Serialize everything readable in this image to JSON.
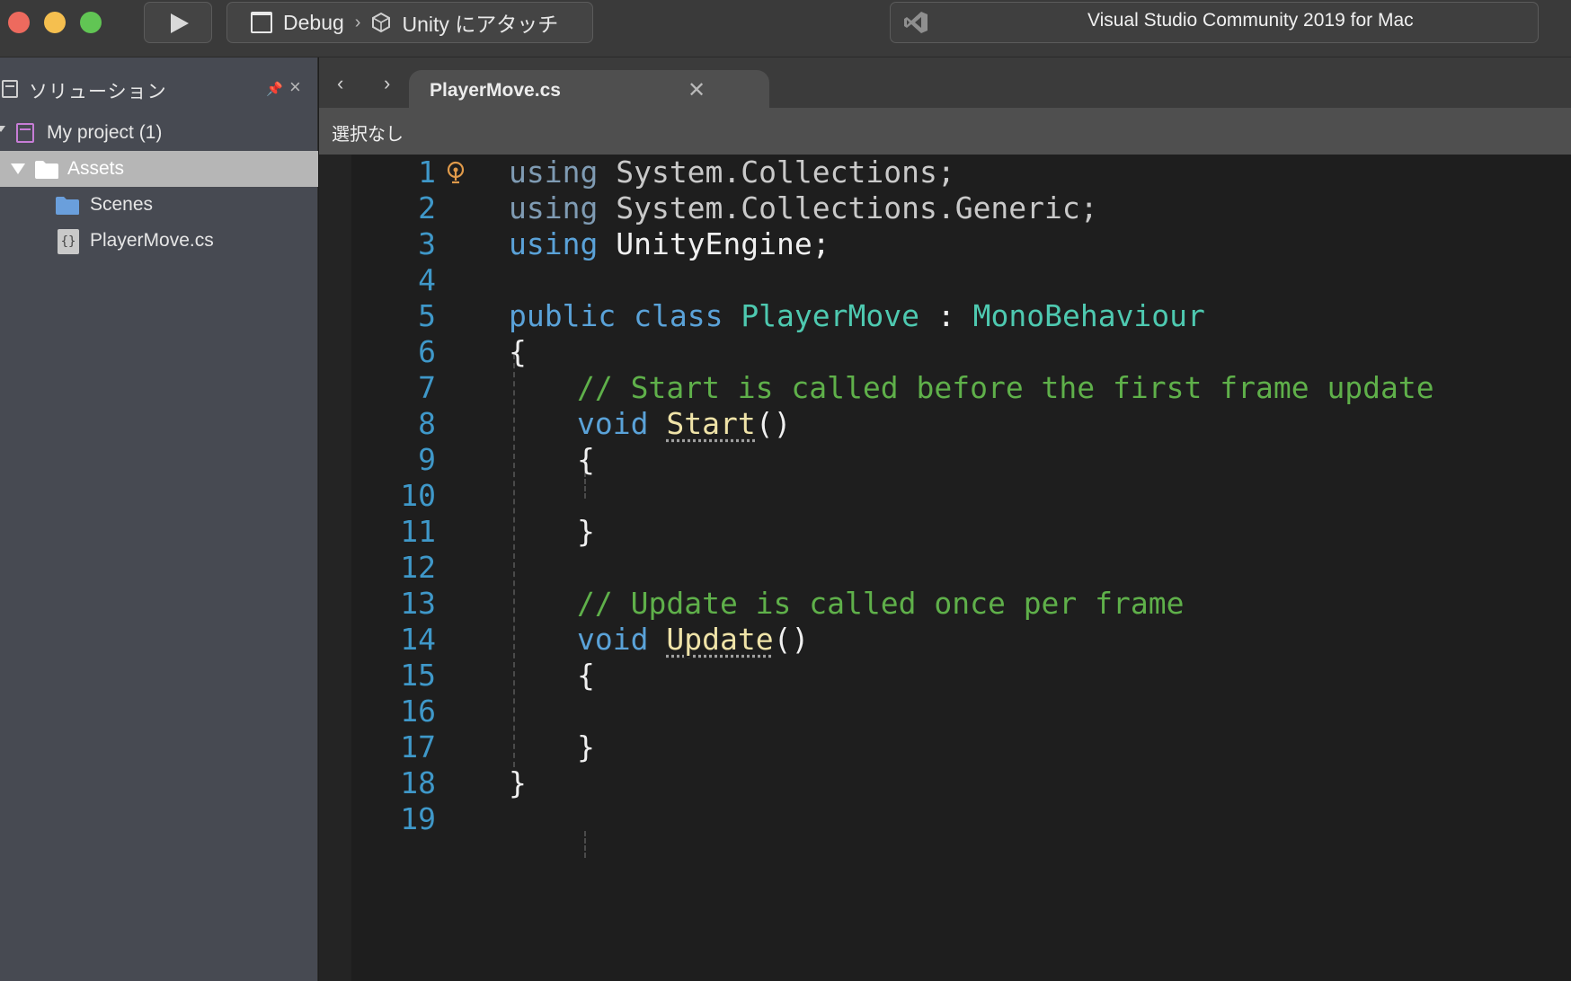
{
  "toolbar": {
    "run_icon": "play-icon",
    "configuration": "Debug",
    "separator": "›",
    "target": "Unity にアタッチ",
    "search_placeholder": "Visual Studio Community 2019 for Mac"
  },
  "sidebar": {
    "title": "ソリューション",
    "tree": {
      "project": "My project (1)",
      "assets": "Assets",
      "scenes": "Scenes",
      "file": "PlayerMove.cs",
      "file_icon_text": "{}"
    }
  },
  "editor": {
    "nav_back": "‹",
    "nav_forward": "›",
    "tab_label": "PlayerMove.cs",
    "tab_close": "✕",
    "path_selection": "選択なし",
    "colors": {
      "keyword": "#5aa2d8",
      "type": "#4ec9b0",
      "comment": "#5fb04a",
      "line_number": "#3f98c9",
      "method": "#efe3a8"
    },
    "lines": [
      {
        "n": "1",
        "kw": "using",
        "rest": " System.Collections;"
      },
      {
        "n": "2",
        "kw": "using",
        "rest": " System.Collections.Generic;"
      },
      {
        "n": "3",
        "kw": "using",
        "rest": " UnityEngine;"
      },
      {
        "n": "4"
      },
      {
        "n": "5",
        "kw1": "public",
        "kw2": "class",
        "type1": "PlayerMove",
        "colon": ":",
        "type2": "MonoBehaviour"
      },
      {
        "n": "6",
        "text": "{"
      },
      {
        "n": "7",
        "comment": "// Start is called before the first frame update"
      },
      {
        "n": "8",
        "kw": "void",
        "method": "Start",
        "rest": "()"
      },
      {
        "n": "9",
        "text": "{"
      },
      {
        "n": "10"
      },
      {
        "n": "11",
        "text": "}"
      },
      {
        "n": "12"
      },
      {
        "n": "13",
        "comment": "// Update is called once per frame"
      },
      {
        "n": "14",
        "kw": "void",
        "method": "Update",
        "rest": "()"
      },
      {
        "n": "15",
        "text": "{"
      },
      {
        "n": "16"
      },
      {
        "n": "17",
        "text": "}"
      },
      {
        "n": "18",
        "text": "}"
      },
      {
        "n": "19"
      }
    ]
  }
}
